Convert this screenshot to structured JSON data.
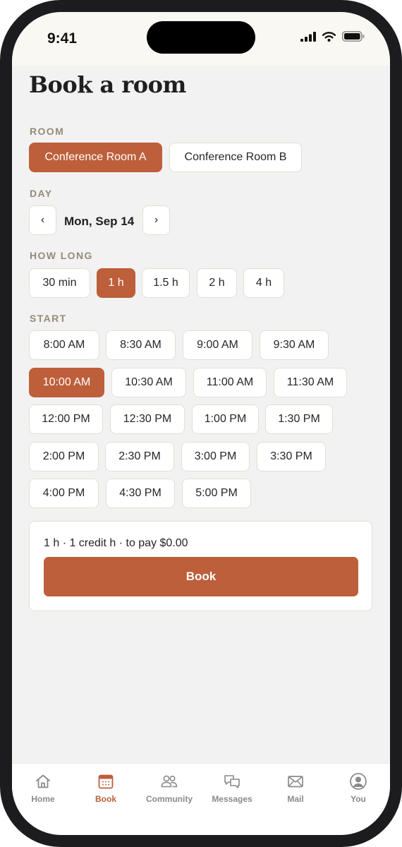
{
  "status_bar": {
    "time": "9:41"
  },
  "page": {
    "title": "Book a room"
  },
  "room": {
    "label": "ROOM",
    "options": [
      "Conference Room A",
      "Conference Room B"
    ],
    "selected": "Conference Room A"
  },
  "day": {
    "label": "DAY",
    "prev": "‹",
    "value": "Mon, Sep 14",
    "next": "›"
  },
  "duration": {
    "label": "HOW LONG",
    "options": [
      "30 min",
      "1 h",
      "1.5 h",
      "2 h",
      "4 h"
    ],
    "selected": "1 h"
  },
  "start": {
    "label": "START",
    "options": [
      "8:00 AM",
      "8:30 AM",
      "9:00 AM",
      "9:30 AM",
      "10:00 AM",
      "10:30 AM",
      "11:00 AM",
      "11:30 AM",
      "12:00 PM",
      "12:30 PM",
      "1:00 PM",
      "1:30 PM",
      "2:00 PM",
      "2:30 PM",
      "3:00 PM",
      "3:30 PM",
      "4:00 PM",
      "4:30 PM",
      "5:00 PM"
    ],
    "selected": "10:00 AM"
  },
  "summary": {
    "text": "1 h · 1 credit h · to pay $0.00",
    "book_label": "Book"
  },
  "tabs": [
    {
      "label": "Home",
      "icon": "home-icon"
    },
    {
      "label": "Book",
      "icon": "calendar-icon"
    },
    {
      "label": "Community",
      "icon": "people-icon"
    },
    {
      "label": "Messages",
      "icon": "chat-bubbles-icon"
    },
    {
      "label": "Mail",
      "icon": "envelope-icon"
    },
    {
      "label": "You",
      "icon": "profile-icon"
    }
  ],
  "active_tab": "Book",
  "colors": {
    "accent": "#bd5f3b",
    "label": "#958b78",
    "background": "#f2f2f2"
  }
}
